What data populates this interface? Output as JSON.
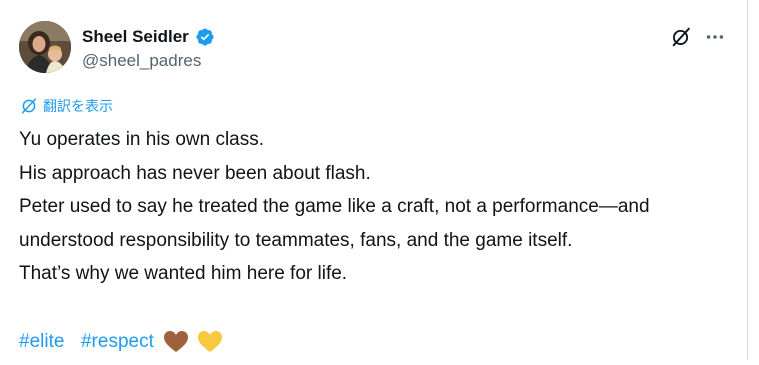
{
  "user": {
    "display_name": "Sheel Seidler",
    "handle": "@sheel_padres",
    "verified": true,
    "verified_color": "#1d9bf0"
  },
  "actions": {
    "grok_icon": "grok-icon",
    "more_icon": "more-icon"
  },
  "translate": {
    "label": "翻訳を表示",
    "icon": "translate-icon"
  },
  "post": {
    "lines": [
      "Yu operates in his own class.",
      "His approach has never been about flash.",
      "Peter used to say he treated the game like a craft, not a performance—and",
      "understood responsibility to teammates, fans, and the game itself.",
      "That’s why we wanted him here for life."
    ],
    "hashtags": [
      "#elite",
      "#respect"
    ],
    "emojis": [
      "brown-heart",
      "yellow-heart"
    ]
  },
  "colors": {
    "text": "#0f1419",
    "secondary": "#536471",
    "accent": "#1d9bf0",
    "brown_heart": "#a0603d",
    "yellow_heart": "#f8c93e"
  }
}
